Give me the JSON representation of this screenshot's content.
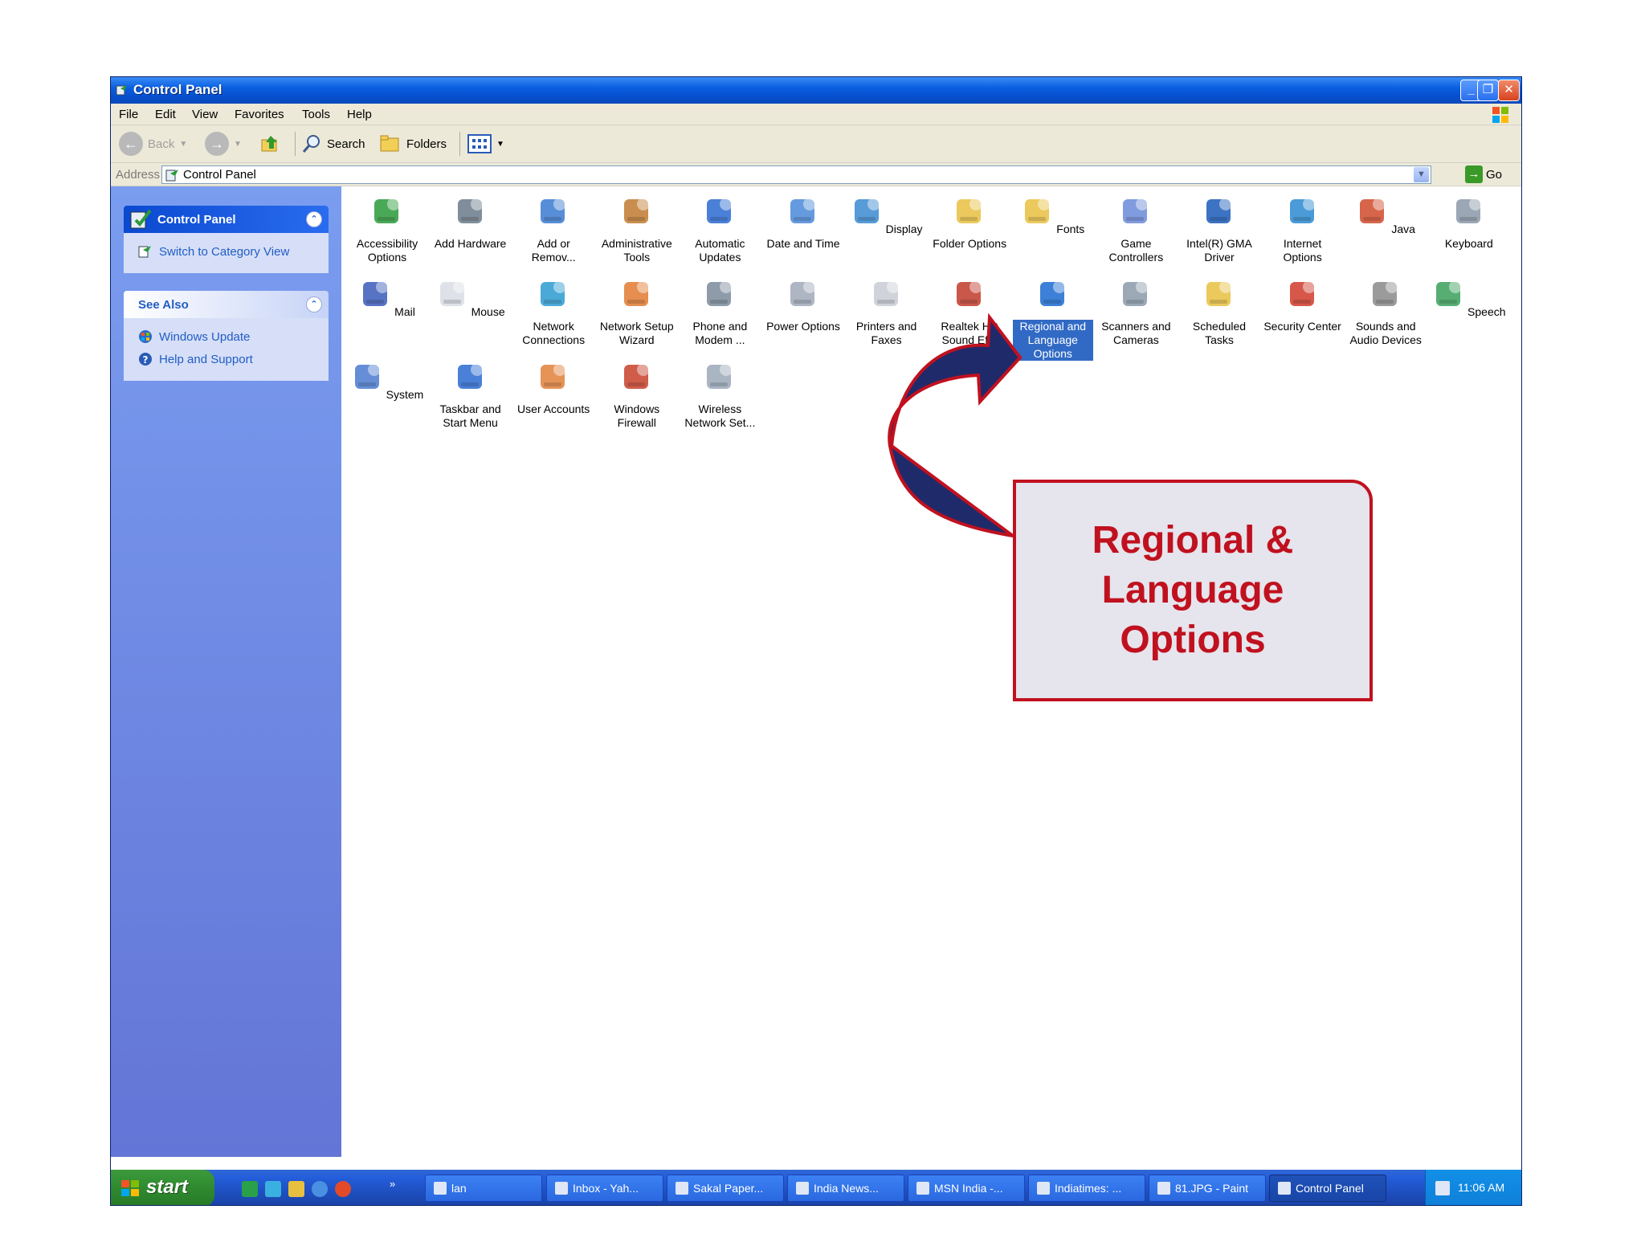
{
  "window": {
    "title": "Control Panel",
    "buttons": {
      "minimize": "_",
      "restore": "❐",
      "close": "✕"
    }
  },
  "menu": [
    "File",
    "Edit",
    "View",
    "Favorites",
    "Tools",
    "Help"
  ],
  "toolbar": {
    "back": "Back",
    "search": "Search",
    "folders": "Folders"
  },
  "address": {
    "label": "Address",
    "value": "Control Panel",
    "go": "Go"
  },
  "left_pane": {
    "control_panel": {
      "title": "Control Panel",
      "link": "Switch to Category View"
    },
    "see_also": {
      "title": "See Also",
      "links": [
        "Windows Update",
        "Help and Support"
      ]
    }
  },
  "items": [
    {
      "label": "Accessibility Options",
      "icon": "accessibility-icon"
    },
    {
      "label": "Add Hardware",
      "icon": "add-hardware-icon"
    },
    {
      "label": "Add or Remov...",
      "icon": "add-remove-programs-icon"
    },
    {
      "label": "Administrative Tools",
      "icon": "administrative-tools-icon"
    },
    {
      "label": "Automatic Updates",
      "icon": "automatic-updates-icon"
    },
    {
      "label": "Date and Time",
      "icon": "date-time-icon"
    },
    {
      "label": "Display",
      "icon": "display-icon"
    },
    {
      "label": "Folder Options",
      "icon": "folder-options-icon"
    },
    {
      "label": "Fonts",
      "icon": "fonts-icon"
    },
    {
      "label": "Game Controllers",
      "icon": "game-controllers-icon"
    },
    {
      "label": "Intel(R) GMA Driver",
      "icon": "intel-gma-icon"
    },
    {
      "label": "Internet Options",
      "icon": "internet-options-icon"
    },
    {
      "label": "Java",
      "icon": "java-icon"
    },
    {
      "label": "Keyboard",
      "icon": "keyboard-icon"
    },
    {
      "label": "Mail",
      "icon": "mail-icon"
    },
    {
      "label": "Mouse",
      "icon": "mouse-icon"
    },
    {
      "label": "Network Connections",
      "icon": "network-connections-icon"
    },
    {
      "label": "Network Setup Wizard",
      "icon": "network-setup-icon"
    },
    {
      "label": "Phone and Modem ...",
      "icon": "phone-modem-icon"
    },
    {
      "label": "Power Options",
      "icon": "power-options-icon"
    },
    {
      "label": "Printers and Faxes",
      "icon": "printers-icon"
    },
    {
      "label": "Realtek HD Sound Ef...",
      "icon": "realtek-sound-icon"
    },
    {
      "label": "Regional and Language Options",
      "icon": "regional-language-icon",
      "selected": true
    },
    {
      "label": "Scanners and Cameras",
      "icon": "scanners-icon"
    },
    {
      "label": "Scheduled Tasks",
      "icon": "scheduled-tasks-icon"
    },
    {
      "label": "Security Center",
      "icon": "security-center-icon"
    },
    {
      "label": "Sounds and Audio Devices",
      "icon": "sounds-icon"
    },
    {
      "label": "Speech",
      "icon": "speech-icon"
    },
    {
      "label": "System",
      "icon": "system-icon"
    },
    {
      "label": "Taskbar and Start Menu",
      "icon": "taskbar-icon"
    },
    {
      "label": "User Accounts",
      "icon": "user-accounts-icon"
    },
    {
      "label": "Windows Firewall",
      "icon": "firewall-icon"
    },
    {
      "label": "Wireless Network Set...",
      "icon": "wireless-icon"
    }
  ],
  "taskbar": {
    "start": "start",
    "tasks": [
      "lan",
      "Inbox - Yah...",
      "Sakal Paper...",
      "India News...",
      "MSN India -...",
      "Indiatimes: ...",
      "81.JPG - Paint",
      "Control Panel"
    ],
    "active_task": "Control Panel",
    "clock": "11:06 AM"
  },
  "callout": {
    "text": "Regional &\nLanguage\nOptions",
    "color": "#c0111f"
  },
  "colors": {
    "titlebar": "#0a5fe0",
    "leftpane": "#7a9df0",
    "selection": "#316ac5",
    "arrow_fill": "#1f2a6b"
  }
}
